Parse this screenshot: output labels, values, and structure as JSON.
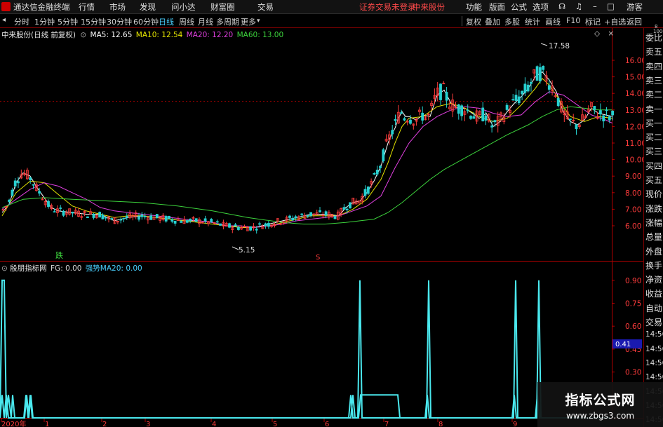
{
  "titlebar": {
    "app_name": "通达信金融终端",
    "menus": [
      "行情",
      "市场",
      "发现",
      "问小达",
      "财富圈",
      "交易"
    ],
    "login_status": "证券交易未登录",
    "stock": "中来股份",
    "right_menus": [
      "功能",
      "版面",
      "公式",
      "选项"
    ],
    "guest": "游客"
  },
  "toolbar": {
    "left": [
      "分时",
      "1分钟",
      "5分钟",
      "15分钟",
      "30分钟",
      "60分钟",
      "日线",
      "周线",
      "月线",
      "多周期",
      "更多"
    ],
    "selected": "日线",
    "right": [
      "复权",
      "叠加",
      "多股",
      "统计",
      "画线",
      "F10",
      "标记",
      "+自选",
      "返回"
    ]
  },
  "main_chart": {
    "title": "中来股份(日线 前复权)",
    "ma": [
      {
        "name": "MA5",
        "value": "12.65",
        "color": "#ffffff"
      },
      {
        "name": "MA10",
        "value": "12.54",
        "color": "#e6e600"
      },
      {
        "name": "MA20",
        "value": "12.20",
        "color": "#e040e0"
      },
      {
        "name": "MA60",
        "value": "13.00",
        "color": "#3cd23c"
      }
    ],
    "high_label": "17.58",
    "low_label": "5.15",
    "marker_die": "跌",
    "marker_s": "S",
    "corner_mark": "◇"
  },
  "chart_data": [
    {
      "type": "candlestick",
      "title": "中来股份(日线 前复权)",
      "y_ticks": [
        "16.00",
        "15.00",
        "14.00",
        "13.00",
        "12.00",
        "11.00",
        "10.00",
        "9.00",
        "8.00",
        "7.00",
        "6.00"
      ],
      "ylim": [
        5.0,
        18.1
      ],
      "annotations": [
        "17.58",
        "5.15"
      ],
      "series": [
        {
          "name": "MA5",
          "color": "#ffffff",
          "points": [
            [
              0,
              6.8
            ],
            [
              10,
              7.3
            ],
            [
              20,
              8.6
            ],
            [
              30,
              9.2
            ],
            [
              40,
              9.0
            ],
            [
              50,
              8.3
            ],
            [
              60,
              7.7
            ],
            [
              70,
              7.1
            ],
            [
              80,
              6.9
            ],
            [
              100,
              6.8
            ],
            [
              120,
              6.7
            ],
            [
              140,
              6.7
            ],
            [
              160,
              6.3
            ],
            [
              180,
              6.5
            ],
            [
              200,
              6.6
            ],
            [
              220,
              6.5
            ],
            [
              240,
              6.4
            ],
            [
              260,
              6.3
            ],
            [
              280,
              6.3
            ],
            [
              300,
              6.2
            ],
            [
              320,
              6.0
            ],
            [
              340,
              5.9
            ],
            [
              360,
              5.9
            ],
            [
              380,
              6.1
            ],
            [
              400,
              6.3
            ],
            [
              420,
              6.5
            ],
            [
              440,
              6.7
            ],
            [
              460,
              6.7
            ],
            [
              480,
              6.6
            ],
            [
              490,
              7.1
            ],
            [
              500,
              7.4
            ],
            [
              510,
              7.5
            ],
            [
              520,
              8.0
            ],
            [
              530,
              8.7
            ],
            [
              540,
              9.6
            ],
            [
              550,
              11.0
            ],
            [
              555,
              11.5
            ],
            [
              560,
              11.9
            ],
            [
              565,
              12.5
            ],
            [
              570,
              12.9
            ],
            [
              575,
              12.6
            ],
            [
              580,
              12.6
            ],
            [
              590,
              12.4
            ],
            [
              600,
              12.7
            ],
            [
              610,
              12.6
            ],
            [
              620,
              13.9
            ],
            [
              630,
              14.2
            ],
            [
              640,
              13.4
            ],
            [
              650,
              13.1
            ],
            [
              660,
              13.1
            ],
            [
              670,
              12.8
            ],
            [
              680,
              12.5
            ],
            [
              690,
              12.8
            ],
            [
              700,
              12.0
            ],
            [
              710,
              12.3
            ],
            [
              720,
              12.9
            ],
            [
              730,
              13.4
            ],
            [
              740,
              13.8
            ],
            [
              750,
              14.3
            ],
            [
              760,
              15.0
            ],
            [
              770,
              15.3
            ],
            [
              780,
              14.8
            ],
            [
              790,
              14.1
            ],
            [
              800,
              12.9
            ],
            [
              810,
              12.3
            ],
            [
              820,
              12.1
            ],
            [
              830,
              12.4
            ],
            [
              840,
              13.1
            ],
            [
              850,
              12.8
            ],
            [
              860,
              12.7
            ],
            [
              870,
              12.6
            ]
          ]
        },
        {
          "name": "MA10",
          "color": "#e6e600",
          "points": [
            [
              0,
              6.6
            ],
            [
              20,
              8.0
            ],
            [
              40,
              8.7
            ],
            [
              60,
              8.6
            ],
            [
              80,
              7.9
            ],
            [
              100,
              7.2
            ],
            [
              120,
              6.9
            ],
            [
              140,
              6.7
            ],
            [
              160,
              6.5
            ],
            [
              180,
              6.6
            ],
            [
              200,
              6.6
            ],
            [
              220,
              6.5
            ],
            [
              240,
              6.4
            ],
            [
              260,
              6.3
            ],
            [
              280,
              6.2
            ],
            [
              300,
              6.1
            ],
            [
              320,
              6.0
            ],
            [
              340,
              5.9
            ],
            [
              360,
              5.9
            ],
            [
              380,
              6.0
            ],
            [
              400,
              6.2
            ],
            [
              420,
              6.4
            ],
            [
              440,
              6.6
            ],
            [
              460,
              6.6
            ],
            [
              480,
              6.6
            ],
            [
              500,
              7.0
            ],
            [
              520,
              7.6
            ],
            [
              540,
              8.8
            ],
            [
              550,
              9.8
            ],
            [
              560,
              11.0
            ],
            [
              570,
              12.0
            ],
            [
              580,
              12.5
            ],
            [
              600,
              12.6
            ],
            [
              620,
              13.2
            ],
            [
              640,
              13.4
            ],
            [
              660,
              13.1
            ],
            [
              680,
              12.6
            ],
            [
              700,
              12.3
            ],
            [
              720,
              12.5
            ],
            [
              740,
              13.3
            ],
            [
              760,
              14.3
            ],
            [
              770,
              14.9
            ],
            [
              780,
              14.5
            ],
            [
              790,
              13.9
            ],
            [
              800,
              13.2
            ],
            [
              810,
              12.6
            ],
            [
              830,
              12.3
            ],
            [
              850,
              12.6
            ],
            [
              870,
              12.5
            ]
          ]
        },
        {
          "name": "MA20",
          "color": "#e040e0",
          "points": [
            [
              0,
              7.0
            ],
            [
              20,
              7.6
            ],
            [
              40,
              8.2
            ],
            [
              60,
              8.6
            ],
            [
              80,
              8.4
            ],
            [
              100,
              8.0
            ],
            [
              120,
              7.6
            ],
            [
              140,
              7.1
            ],
            [
              160,
              6.9
            ],
            [
              180,
              6.8
            ],
            [
              200,
              6.7
            ],
            [
              220,
              6.6
            ],
            [
              240,
              6.5
            ],
            [
              260,
              6.4
            ],
            [
              280,
              6.3
            ],
            [
              300,
              6.2
            ],
            [
              320,
              6.0
            ],
            [
              340,
              6.0
            ],
            [
              360,
              5.9
            ],
            [
              380,
              6.0
            ],
            [
              400,
              6.1
            ],
            [
              420,
              6.3
            ],
            [
              440,
              6.4
            ],
            [
              460,
              6.5
            ],
            [
              480,
              6.6
            ],
            [
              500,
              6.9
            ],
            [
              520,
              7.2
            ],
            [
              540,
              7.8
            ],
            [
              560,
              9.5
            ],
            [
              580,
              11.0
            ],
            [
              600,
              12.0
            ],
            [
              620,
              12.6
            ],
            [
              640,
              13.0
            ],
            [
              660,
              13.2
            ],
            [
              680,
              13.1
            ],
            [
              700,
              12.8
            ],
            [
              720,
              12.6
            ],
            [
              740,
              12.7
            ],
            [
              760,
              13.5
            ],
            [
              780,
              14.1
            ],
            [
              800,
              13.9
            ],
            [
              820,
              13.3
            ],
            [
              840,
              12.7
            ],
            [
              860,
              12.4
            ],
            [
              870,
              12.2
            ]
          ]
        },
        {
          "name": "MA60",
          "color": "#3cd23c",
          "points": [
            [
              0,
              7.1
            ],
            [
              30,
              7.6
            ],
            [
              60,
              7.7
            ],
            [
              100,
              7.6
            ],
            [
              150,
              7.5
            ],
            [
              200,
              7.4
            ],
            [
              250,
              7.2
            ],
            [
              300,
              6.9
            ],
            [
              350,
              6.5
            ],
            [
              400,
              6.2
            ],
            [
              430,
              6.1
            ],
            [
              460,
              6.1
            ],
            [
              490,
              6.2
            ],
            [
              510,
              6.3
            ],
            [
              530,
              6.4
            ],
            [
              550,
              6.8
            ],
            [
              570,
              7.4
            ],
            [
              590,
              8.1
            ],
            [
              610,
              8.8
            ],
            [
              630,
              9.4
            ],
            [
              660,
              10.1
            ],
            [
              690,
              10.8
            ],
            [
              720,
              11.5
            ],
            [
              750,
              12.1
            ],
            [
              770,
              12.6
            ],
            [
              790,
              13.0
            ],
            [
              810,
              13.2
            ],
            [
              830,
              13.1
            ],
            [
              850,
              13.0
            ],
            [
              870,
              13.0
            ]
          ]
        }
      ]
    },
    {
      "type": "line",
      "title": "殷朋指标网",
      "legend": [
        {
          "name": "FG",
          "value": "0.00",
          "color": "#d8d8d8"
        },
        {
          "name": "强势MA20",
          "value": "0.00",
          "color": "#4ad0ff"
        }
      ],
      "y_ticks": [
        "0.90",
        "0.75",
        "0.60",
        "0.45",
        "0.30"
      ],
      "current_value": "0.41",
      "ylim": [
        0,
        0.97
      ],
      "fg": [
        [
          0,
          0
        ],
        [
          3,
          0.9
        ],
        [
          6,
          0.9
        ],
        [
          9,
          0
        ],
        [
          12,
          0.15
        ],
        [
          16,
          0
        ],
        [
          18,
          0.15
        ],
        [
          21,
          0
        ],
        [
          35,
          0
        ],
        [
          38,
          0.15
        ],
        [
          41,
          0
        ],
        [
          44,
          0.15
        ],
        [
          47,
          0
        ],
        [
          500,
          0
        ],
        [
          503,
          0.15
        ],
        [
          506,
          0
        ],
        [
          510,
          0
        ],
        [
          513,
          0.9
        ],
        [
          516,
          0
        ],
        [
          608,
          0
        ],
        [
          611,
          0.9
        ],
        [
          614,
          0
        ],
        [
          732,
          0
        ],
        [
          735,
          0.9
        ],
        [
          738,
          0
        ],
        [
          765,
          0
        ],
        [
          768,
          0.9
        ],
        [
          771,
          0
        ],
        [
          870,
          0
        ]
      ],
      "strong": [
        [
          0,
          0
        ],
        [
          3,
          0.15
        ],
        [
          6,
          0
        ],
        [
          9,
          0.15
        ],
        [
          12,
          0
        ],
        [
          34,
          0
        ],
        [
          37,
          0.15
        ],
        [
          40,
          0
        ],
        [
          43,
          0.15
        ],
        [
          46,
          0
        ],
        [
          497,
          0
        ],
        [
          500,
          0.15
        ],
        [
          503,
          0
        ],
        [
          511,
          0
        ],
        [
          514,
          0.15
        ],
        [
          516,
          0.15
        ],
        [
          567,
          0.15
        ],
        [
          570,
          0
        ],
        [
          606,
          0
        ],
        [
          609,
          0.15
        ],
        [
          612,
          0
        ],
        [
          730,
          0
        ],
        [
          733,
          0.15
        ],
        [
          736,
          0
        ],
        [
          763,
          0
        ],
        [
          766,
          0.15
        ],
        [
          769,
          0
        ],
        [
          870,
          0
        ]
      ]
    }
  ],
  "indicator": {
    "title": "殷朋指标网",
    "current_value": "0.41"
  },
  "x_axis": {
    "labels": [
      "2020年",
      "1",
      "2",
      "3",
      "4",
      "5",
      "6",
      "7",
      "8",
      "9"
    ]
  },
  "right_panel": {
    "items": [
      "委比",
      "卖五",
      "卖四",
      "卖三",
      "卖二",
      "卖一",
      "买一",
      "买二",
      "买三",
      "买四",
      "买五",
      "现价",
      "涨跌",
      "涨幅",
      "总量",
      "外盘",
      "换手",
      "净资",
      "收益",
      "自动",
      "交易",
      "14:56",
      "14:56",
      "14:56",
      "14:56",
      "14:56",
      "14:56",
      "14:56",
      "14:56"
    ],
    "corner": [
      "8",
      "1000"
    ]
  },
  "watermark": {
    "line1": "指标公式网",
    "line2": "www.zbgs3.com"
  },
  "colors": {
    "up": "#ff3c3c",
    "down": "#26d0d0",
    "grid": "#8a0000",
    "axis": "#b40000",
    "indicator": "#4ae8ee",
    "ma5": "#ffffff",
    "ma10": "#e6e600",
    "ma20": "#e040e0",
    "ma60": "#3cd23c",
    "fg": "#d8d8d8",
    "strong": "#4ad0ff"
  }
}
